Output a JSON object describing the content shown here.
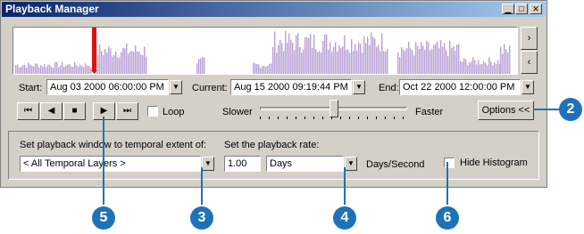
{
  "window": {
    "title": "Playback Manager",
    "controls": {
      "minimize": "▁",
      "maximize": "□",
      "close": "✕"
    }
  },
  "histogram": {
    "bar_color": "#b9a0d6",
    "marker_color": "#e01010",
    "marker_position_fraction": 0.16,
    "scroll_right": "›",
    "scroll_left": "‹"
  },
  "time_range": {
    "start_label": "Start:",
    "start_value": "Aug 03 2000 06:00:00 PM",
    "current_label": "Current:",
    "current_value": "Aug 15 2000 09:19:44 PM",
    "end_label": "End:",
    "end_value": "Oct 22 2000 12:00:00 PM",
    "dropdown_arrow": "▼"
  },
  "playback": {
    "buttons": [
      "⏮",
      "◀",
      "■",
      "▶",
      "⏭"
    ],
    "loop_label": "Loop",
    "slower_label": "Slower",
    "faster_label": "Faster",
    "speed_fraction": 0.5,
    "options_label": "Options <<"
  },
  "options": {
    "window_label": "Set playback window to temporal extent of:",
    "window_value": "< All Temporal Layers >",
    "rate_label": "Set the playback rate:",
    "rate_value": "1.00",
    "rate_unit": "Days",
    "rate_suffix": "Days/Second",
    "hide_histogram_label": "Hide Histogram"
  },
  "callouts": {
    "options": "2",
    "dropdown_window": "3",
    "dropdown_unit": "4",
    "play": "5",
    "hide_histogram": "6"
  },
  "colors": {
    "callout": "#1e73b8",
    "title_start": "#0a246a",
    "title_end": "#a6caf0"
  }
}
